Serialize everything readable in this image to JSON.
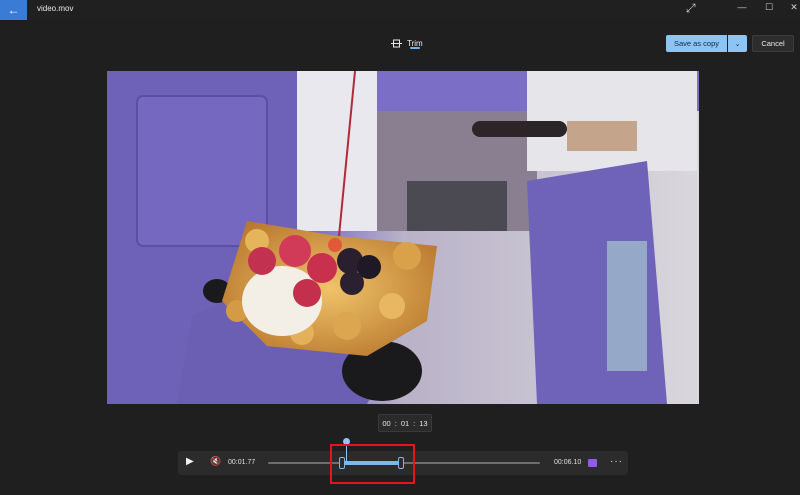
{
  "window": {
    "title": "video.mov",
    "back_icon": "arrow-left-icon",
    "controls": [
      "minimize-icon",
      "maximize-icon",
      "close-icon"
    ]
  },
  "toolbar": {
    "tab_label": "Trim",
    "tab_icon": "trim-icon",
    "save_label": "Save as copy",
    "cancel_label": "Cancel"
  },
  "player": {
    "current_time": {
      "hours": "00",
      "minutes": "01",
      "frames": "13"
    },
    "start_time": "00:01.77",
    "end_time": "00:06.10",
    "selection_start": 0.27,
    "selection_end": 0.49,
    "playhead": 0.285
  },
  "colors": {
    "accent": "#8cc4f5",
    "highlight": "#e8141b",
    "clip": "#8f5ce8"
  }
}
